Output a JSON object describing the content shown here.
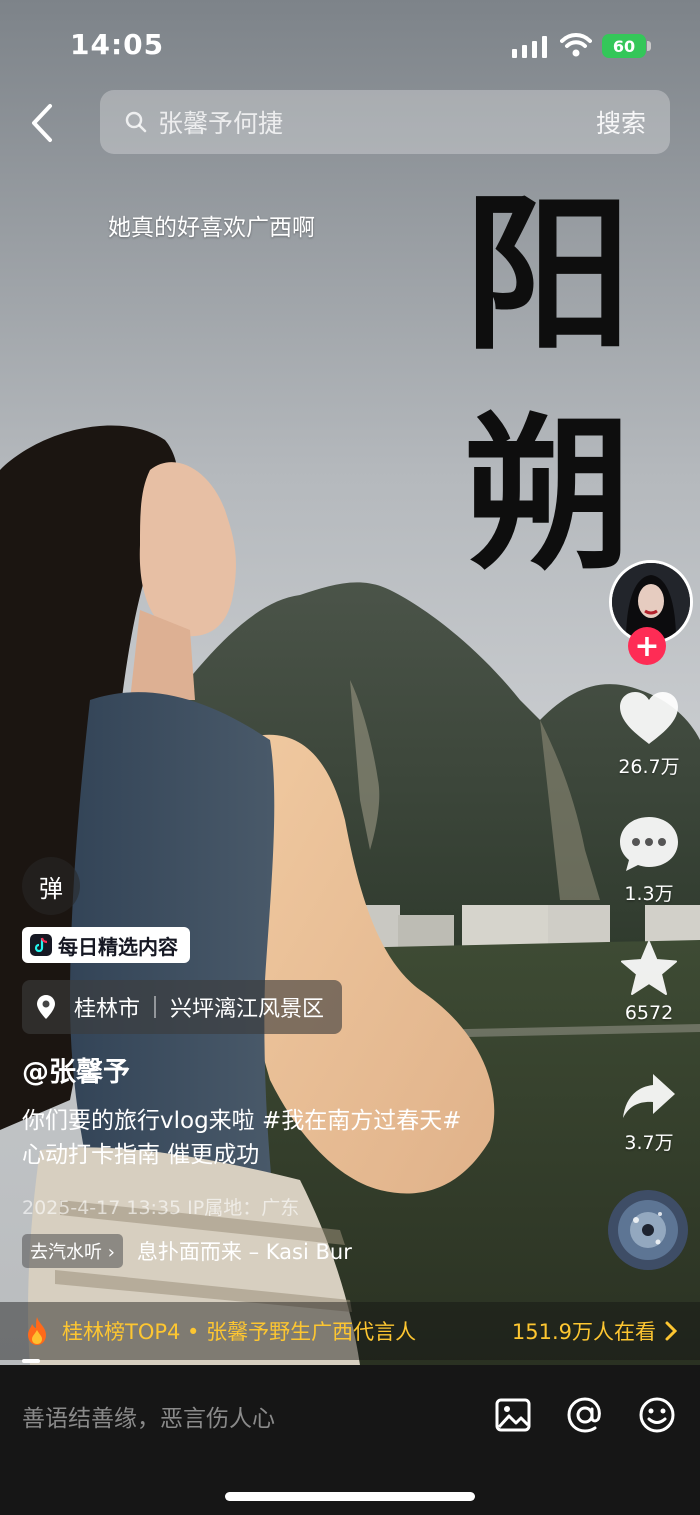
{
  "status_bar": {
    "time": "14:05",
    "battery": "60"
  },
  "search": {
    "query": "张馨予何捷",
    "button_label": "搜索"
  },
  "overlay": {
    "caption": "她真的好喜欢广西啊",
    "big_char_1": "阳",
    "big_char_2": "朔"
  },
  "rail": {
    "likes": "26.7万",
    "comments": "1.3万",
    "favorites": "6572",
    "shares": "3.7万"
  },
  "info": {
    "danmu_label": "弹",
    "daily_tag": "每日精选内容",
    "location_city": "桂林市",
    "location_spot": "兴坪漓江风景区",
    "username": "@张馨予",
    "desc_line1": "你们要的旅行vlog来啦 #我在南方过春天#",
    "desc_line2": "心动打卡指南 催更成功",
    "meta": "2025-4-17 13:35  IP属地：广东",
    "listen_tag": "去汽水听",
    "music_title": "息扑面而来 – Kasi Bur"
  },
  "hot_banner": {
    "text": "桂林榜TOP4 • 张馨予野生广西代言人",
    "viewers": "151.9万人在看"
  },
  "comment_bar": {
    "placeholder": "善语结善缘，恶言伤人心"
  },
  "colors": {
    "accent_red": "#fe2c55",
    "hot_yellow": "#fdc631",
    "battery_green": "#34c759"
  }
}
